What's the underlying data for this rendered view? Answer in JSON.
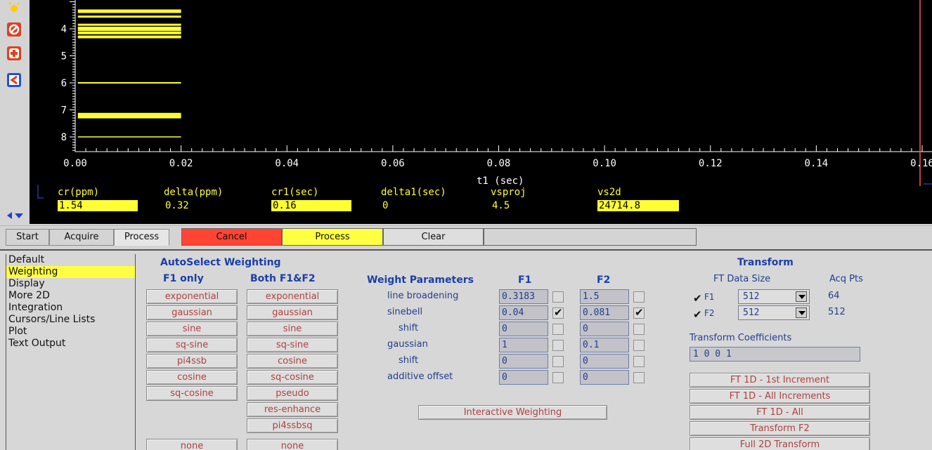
{
  "toolbar": {
    "icons": [
      "sun-icon",
      "no-entry-icon",
      "plus-box-icon",
      "back-arrow-icon"
    ]
  },
  "plot": {
    "y_ticks": [
      "4",
      "5",
      "6",
      "7",
      "8"
    ],
    "x_ticks": [
      "0.00",
      "0.02",
      "0.04",
      "0.06",
      "0.08",
      "0.10",
      "0.12",
      "0.14",
      "0.16"
    ],
    "x_axis_label": "t1 (sec)",
    "params": [
      {
        "name": "cr(ppm)",
        "value": "1.54",
        "highlight": true
      },
      {
        "name": "delta(ppm)",
        "value": "0.32",
        "highlight": false
      },
      {
        "name": "cr1(sec)",
        "value": "0.16",
        "highlight": true
      },
      {
        "name": "delta1(sec)",
        "value": "0",
        "highlight": false
      },
      {
        "name": "vsproj",
        "value": "4.5",
        "highlight": false
      },
      {
        "name": "vs2d",
        "value": "24714.8",
        "highlight": true
      }
    ]
  },
  "tabs": [
    "Start",
    "Acquire",
    "Process"
  ],
  "actions": {
    "cancel": "Cancel",
    "process": "Process",
    "clear": "Clear"
  },
  "sidebar": {
    "items": [
      "Default",
      "Weighting",
      "Display",
      "More 2D",
      "Integration",
      "Cursors/Line Lists",
      "Plot",
      "Text Output"
    ],
    "selected": "Weighting"
  },
  "autoselect": {
    "title": "AutoSelect Weighting",
    "f1_title": "F1 only",
    "both_title": "Both F1&F2",
    "f1_buttons": [
      "exponential",
      "gaussian",
      "sine",
      "sq-sine",
      "pi4ssb",
      "cosine",
      "sq-cosine"
    ],
    "both_buttons": [
      "exponential",
      "gaussian",
      "sine",
      "sq-sine",
      "cosine",
      "sq-cosine",
      "pseudo",
      "res-enhance",
      "pi4ssbsq"
    ],
    "f1_none": "none",
    "both_none": "none"
  },
  "weight_params": {
    "title": "Weight Parameters",
    "f1_title": "F1",
    "f2_title": "F2",
    "rows": [
      {
        "label": "line broadening",
        "f1": "0.3183",
        "f1_checked": false,
        "f2": "1.5",
        "f2_checked": false
      },
      {
        "label": "sinebell",
        "f1": "0.04",
        "f1_checked": true,
        "f2": "0.081",
        "f2_checked": true
      },
      {
        "label": "shift",
        "f1": "0",
        "f1_checked": false,
        "f2": "0",
        "f2_checked": false
      },
      {
        "label": "gaussian",
        "f1": "1",
        "f1_checked": false,
        "f2": "0.1",
        "f2_checked": false
      },
      {
        "label": "shift",
        "f1": "0",
        "f1_checked": false,
        "f2": "0",
        "f2_checked": false
      },
      {
        "label": "additive offset",
        "f1": "0",
        "f1_checked": false,
        "f2": "0",
        "f2_checked": false
      }
    ],
    "interactive_button": "Interactive Weighting"
  },
  "transform": {
    "title": "Transform",
    "size_header": "FT Data Size",
    "acq_header": "Acq Pts",
    "rows": [
      {
        "label": "F1",
        "checked": true,
        "size": "512",
        "acq": "64"
      },
      {
        "label": "F2",
        "checked": true,
        "size": "512",
        "acq": "512"
      }
    ],
    "coef_label": "Transform Coefficients",
    "coef_value": "1 0 0 1",
    "buttons": [
      "FT 1D - 1st Increment",
      "FT 1D - All Increments",
      "FT 1D - All",
      "Transform F2",
      "Full 2D Transform"
    ]
  },
  "colors": {
    "plot_bg": "#000000",
    "trace": "#ffff33",
    "axis": "#ffffff",
    "cursor": "#ff5555",
    "cancel": "#ff4433",
    "process": "#ffff44",
    "heading": "#1a3fa8",
    "button_text": "#b04040"
  }
}
